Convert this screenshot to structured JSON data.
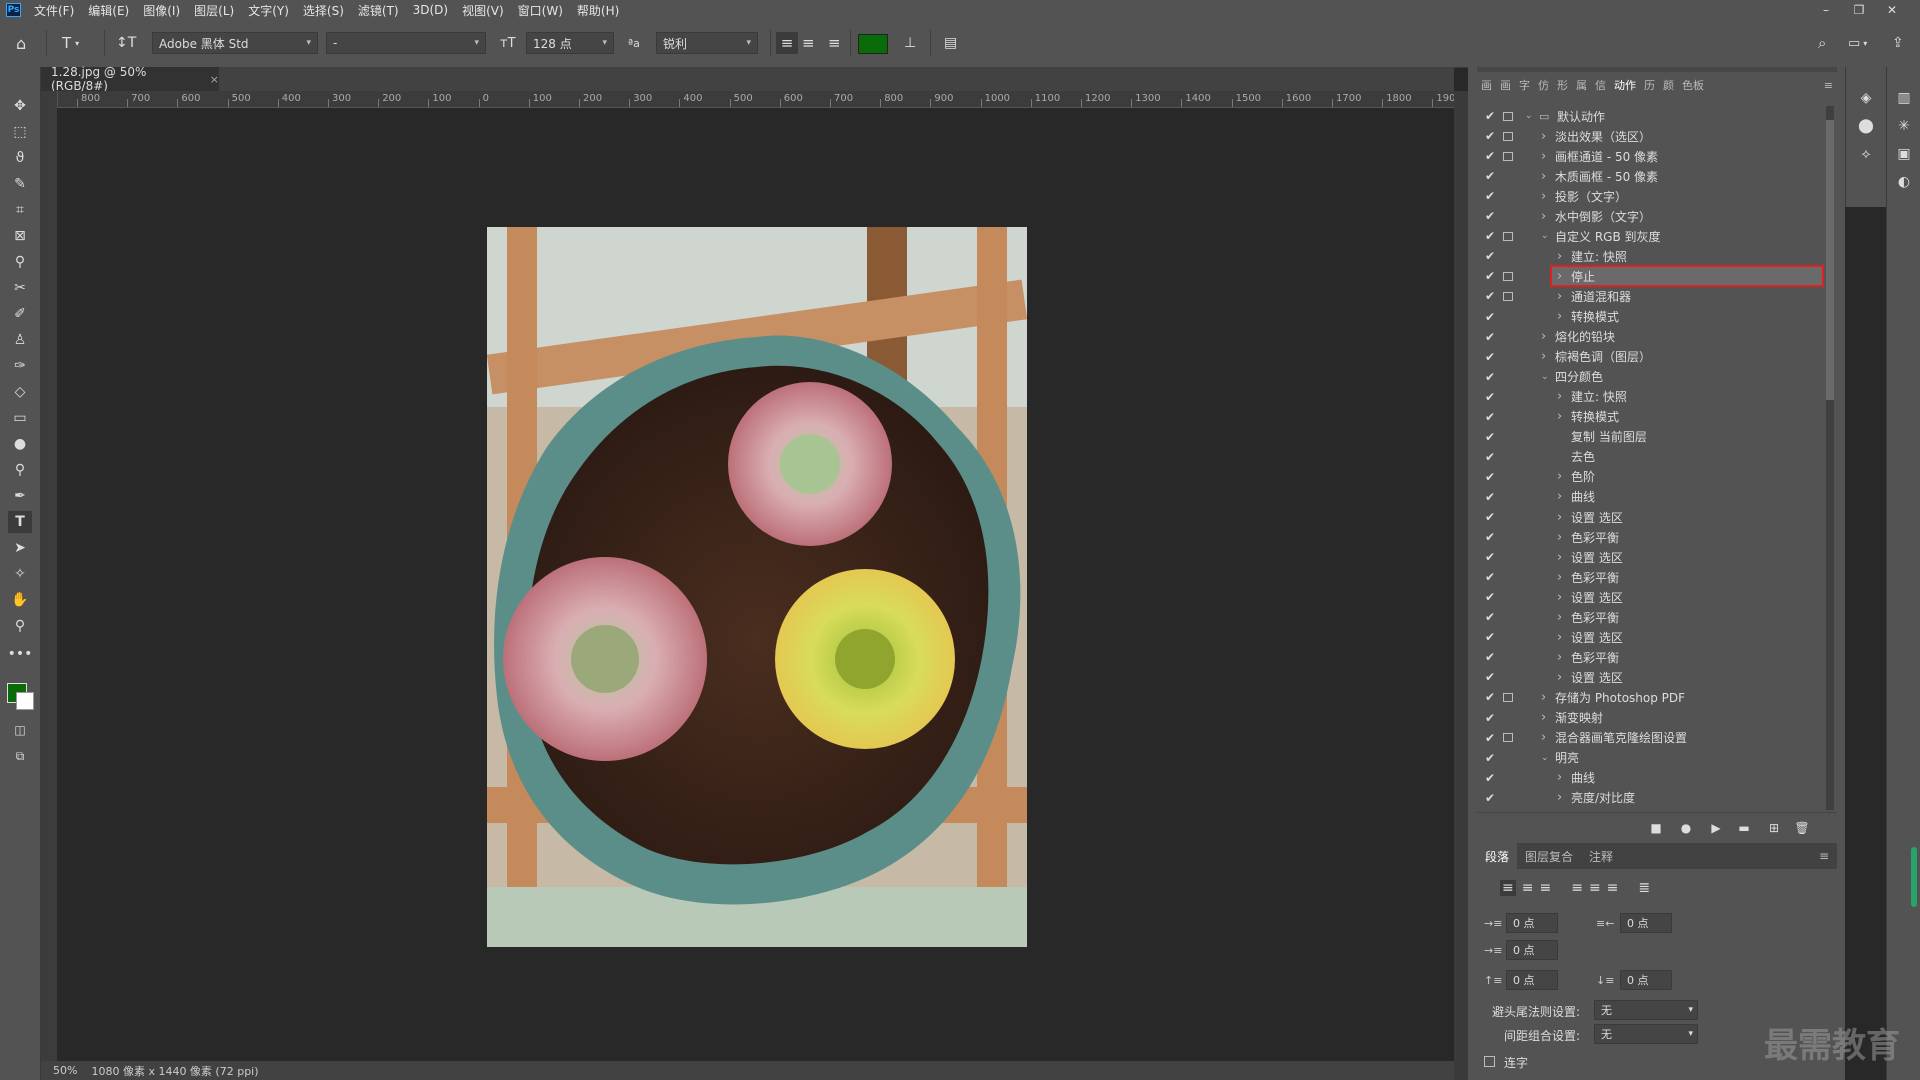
{
  "menubar": {
    "logo": "Ps",
    "items": [
      "文件(F)",
      "编辑(E)",
      "图像(I)",
      "图层(L)",
      "文字(Y)",
      "选择(S)",
      "滤镜(T)",
      "3D(D)",
      "视图(V)",
      "窗口(W)",
      "帮助(H)"
    ],
    "win_controls": [
      "–",
      "❐",
      "✕"
    ]
  },
  "options": {
    "font_family": "Adobe 黑体 Std",
    "font_style": "-",
    "font_size": "128 点",
    "antialias": "锐利",
    "color": "#0a6b0a"
  },
  "document": {
    "tab_title": "1.28.jpg @ 50%(RGB/8#)",
    "zoom": "50%",
    "info": "1080 像素 x 1440 像素 (72 ppi)"
  },
  "ruler_h_labels": [
    "800",
    "700",
    "600",
    "500",
    "400",
    "300",
    "200",
    "100",
    "0",
    "100",
    "200",
    "300",
    "400",
    "500",
    "600",
    "700",
    "800",
    "900",
    "1000",
    "1100",
    "1200",
    "1300",
    "1400",
    "1500",
    "1600",
    "1700",
    "1800",
    "190"
  ],
  "panel_tabs": [
    "画",
    "画",
    "字",
    "仿",
    "形",
    "属",
    "信",
    "动作",
    "历",
    "颜",
    "色板"
  ],
  "actions": [
    {
      "label": "默认动作",
      "level": 0,
      "expanded": true,
      "folder": true,
      "dialog": true
    },
    {
      "label": "淡出效果（选区）",
      "level": 1,
      "expanded": false,
      "dialog": true
    },
    {
      "label": "画框通道 - 50 像素",
      "level": 1,
      "expanded": false,
      "dialog": true
    },
    {
      "label": "木质画框 - 50 像素",
      "level": 1,
      "expanded": false,
      "dialog": false
    },
    {
      "label": "投影（文字）",
      "level": 1,
      "expanded": false,
      "dialog": false
    },
    {
      "label": "水中倒影（文字）",
      "level": 1,
      "expanded": false,
      "dialog": false
    },
    {
      "label": "自定义 RGB 到灰度",
      "level": 1,
      "expanded": true,
      "dialog": true
    },
    {
      "label": "建立: 快照",
      "level": 2,
      "expanded": false,
      "dialog": false
    },
    {
      "label": "停止",
      "level": 2,
      "expanded": false,
      "dialog": true,
      "selected": true
    },
    {
      "label": "通道混和器",
      "level": 2,
      "expanded": false,
      "dialog": true
    },
    {
      "label": "转换模式",
      "level": 2,
      "expanded": false,
      "dialog": false
    },
    {
      "label": "熔化的铅块",
      "level": 1,
      "expanded": false,
      "dialog": false
    },
    {
      "label": "棕褐色调（图层）",
      "level": 1,
      "expanded": false,
      "dialog": false
    },
    {
      "label": "四分颜色",
      "level": 1,
      "expanded": true,
      "dialog": false
    },
    {
      "label": "建立: 快照",
      "level": 2,
      "expanded": false,
      "dialog": false
    },
    {
      "label": "转换模式",
      "level": 2,
      "expanded": false,
      "dialog": false
    },
    {
      "label": "复制 当前图层",
      "level": 2,
      "expanded": null,
      "dialog": false
    },
    {
      "label": "去色",
      "level": 2,
      "expanded": null,
      "dialog": false
    },
    {
      "label": "色阶",
      "level": 2,
      "expanded": false,
      "dialog": false
    },
    {
      "label": "曲线",
      "level": 2,
      "expanded": false,
      "dialog": false
    },
    {
      "label": "设置 选区",
      "level": 2,
      "expanded": false,
      "dialog": false
    },
    {
      "label": "色彩平衡",
      "level": 2,
      "expanded": false,
      "dialog": false
    },
    {
      "label": "设置 选区",
      "level": 2,
      "expanded": false,
      "dialog": false
    },
    {
      "label": "色彩平衡",
      "level": 2,
      "expanded": false,
      "dialog": false
    },
    {
      "label": "设置 选区",
      "level": 2,
      "expanded": false,
      "dialog": false
    },
    {
      "label": "色彩平衡",
      "level": 2,
      "expanded": false,
      "dialog": false
    },
    {
      "label": "设置 选区",
      "level": 2,
      "expanded": false,
      "dialog": false
    },
    {
      "label": "色彩平衡",
      "level": 2,
      "expanded": false,
      "dialog": false
    },
    {
      "label": "设置 选区",
      "level": 2,
      "expanded": false,
      "dialog": false
    },
    {
      "label": "存储为 Photoshop PDF",
      "level": 1,
      "expanded": false,
      "dialog": true
    },
    {
      "label": "渐变映射",
      "level": 1,
      "expanded": false,
      "dialog": false
    },
    {
      "label": "混合器画笔克隆绘图设置",
      "level": 1,
      "expanded": false,
      "dialog": true
    },
    {
      "label": "明亮",
      "level": 1,
      "expanded": true,
      "dialog": false
    },
    {
      "label": "曲线",
      "level": 2,
      "expanded": false,
      "dialog": false
    },
    {
      "label": "亮度/对比度",
      "level": 2,
      "expanded": false,
      "dialog": false
    }
  ],
  "paragraph": {
    "tabs": [
      "段落",
      "图层复合",
      "注释"
    ],
    "indent_left": "0 点",
    "indent_right": "0 点",
    "indent_first": "0 点",
    "space_before": "0 点",
    "space_after": "0 点",
    "kinsoku_label": "避头尾法则设置:",
    "kinsoku_value": "无",
    "mojikumi_label": "间距组合设置:",
    "mojikumi_value": "无",
    "hyphen_label": "连字"
  },
  "watermark": "最需教育"
}
